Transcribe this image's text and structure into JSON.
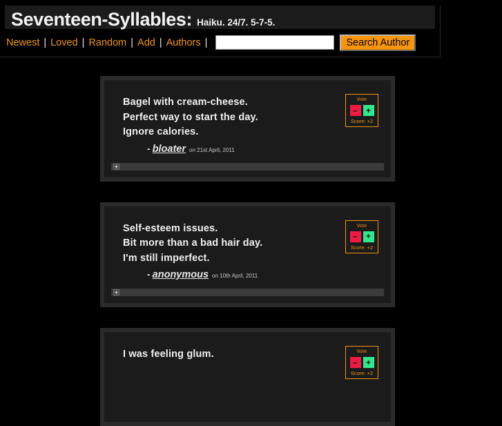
{
  "header": {
    "title": "Seventeen-Syllables:",
    "tagline": "Haiku. 24/7. 5-7-5."
  },
  "nav": {
    "separator": "|",
    "links": [
      {
        "label": "Newest"
      },
      {
        "label": "Loved"
      },
      {
        "label": "Random"
      },
      {
        "label": "Add"
      },
      {
        "label": "Authors"
      }
    ],
    "search": {
      "value": "",
      "placeholder": "",
      "button_label": "Search Author"
    }
  },
  "vote_widget": {
    "label": "Vote",
    "down_symbol": "–",
    "up_symbol": "+",
    "score_prefix": "Score: "
  },
  "colors": {
    "page_background": "#000000",
    "accent_orange": "#f39711",
    "button_orange": "#f9950c",
    "card_background": "#1b1b1b",
    "card_frame": "#2b2b2b",
    "vote_down_red": "#ef1b45",
    "vote_up_green": "#2fe98c",
    "text_white": "#f0f0f0"
  },
  "haikus": [
    {
      "lines": [
        "Bagel with cream-cheese.",
        "Perfect way to start the day.",
        "Ignore calories."
      ],
      "dash": "-",
      "author": "bloater",
      "date": "on 21st April, 2011",
      "score": "+2"
    },
    {
      "lines": [
        "Self-esteem issues.",
        "Bit more than a bad hair day.",
        "I'm still imperfect."
      ],
      "dash": "-",
      "author": "anonymous",
      "date": "on 10th April, 2011",
      "score": "+2"
    },
    {
      "lines": [
        "I was feeling glum.",
        "",
        ""
      ],
      "dash": "-",
      "author": "",
      "date": "",
      "score": "+2"
    }
  ]
}
